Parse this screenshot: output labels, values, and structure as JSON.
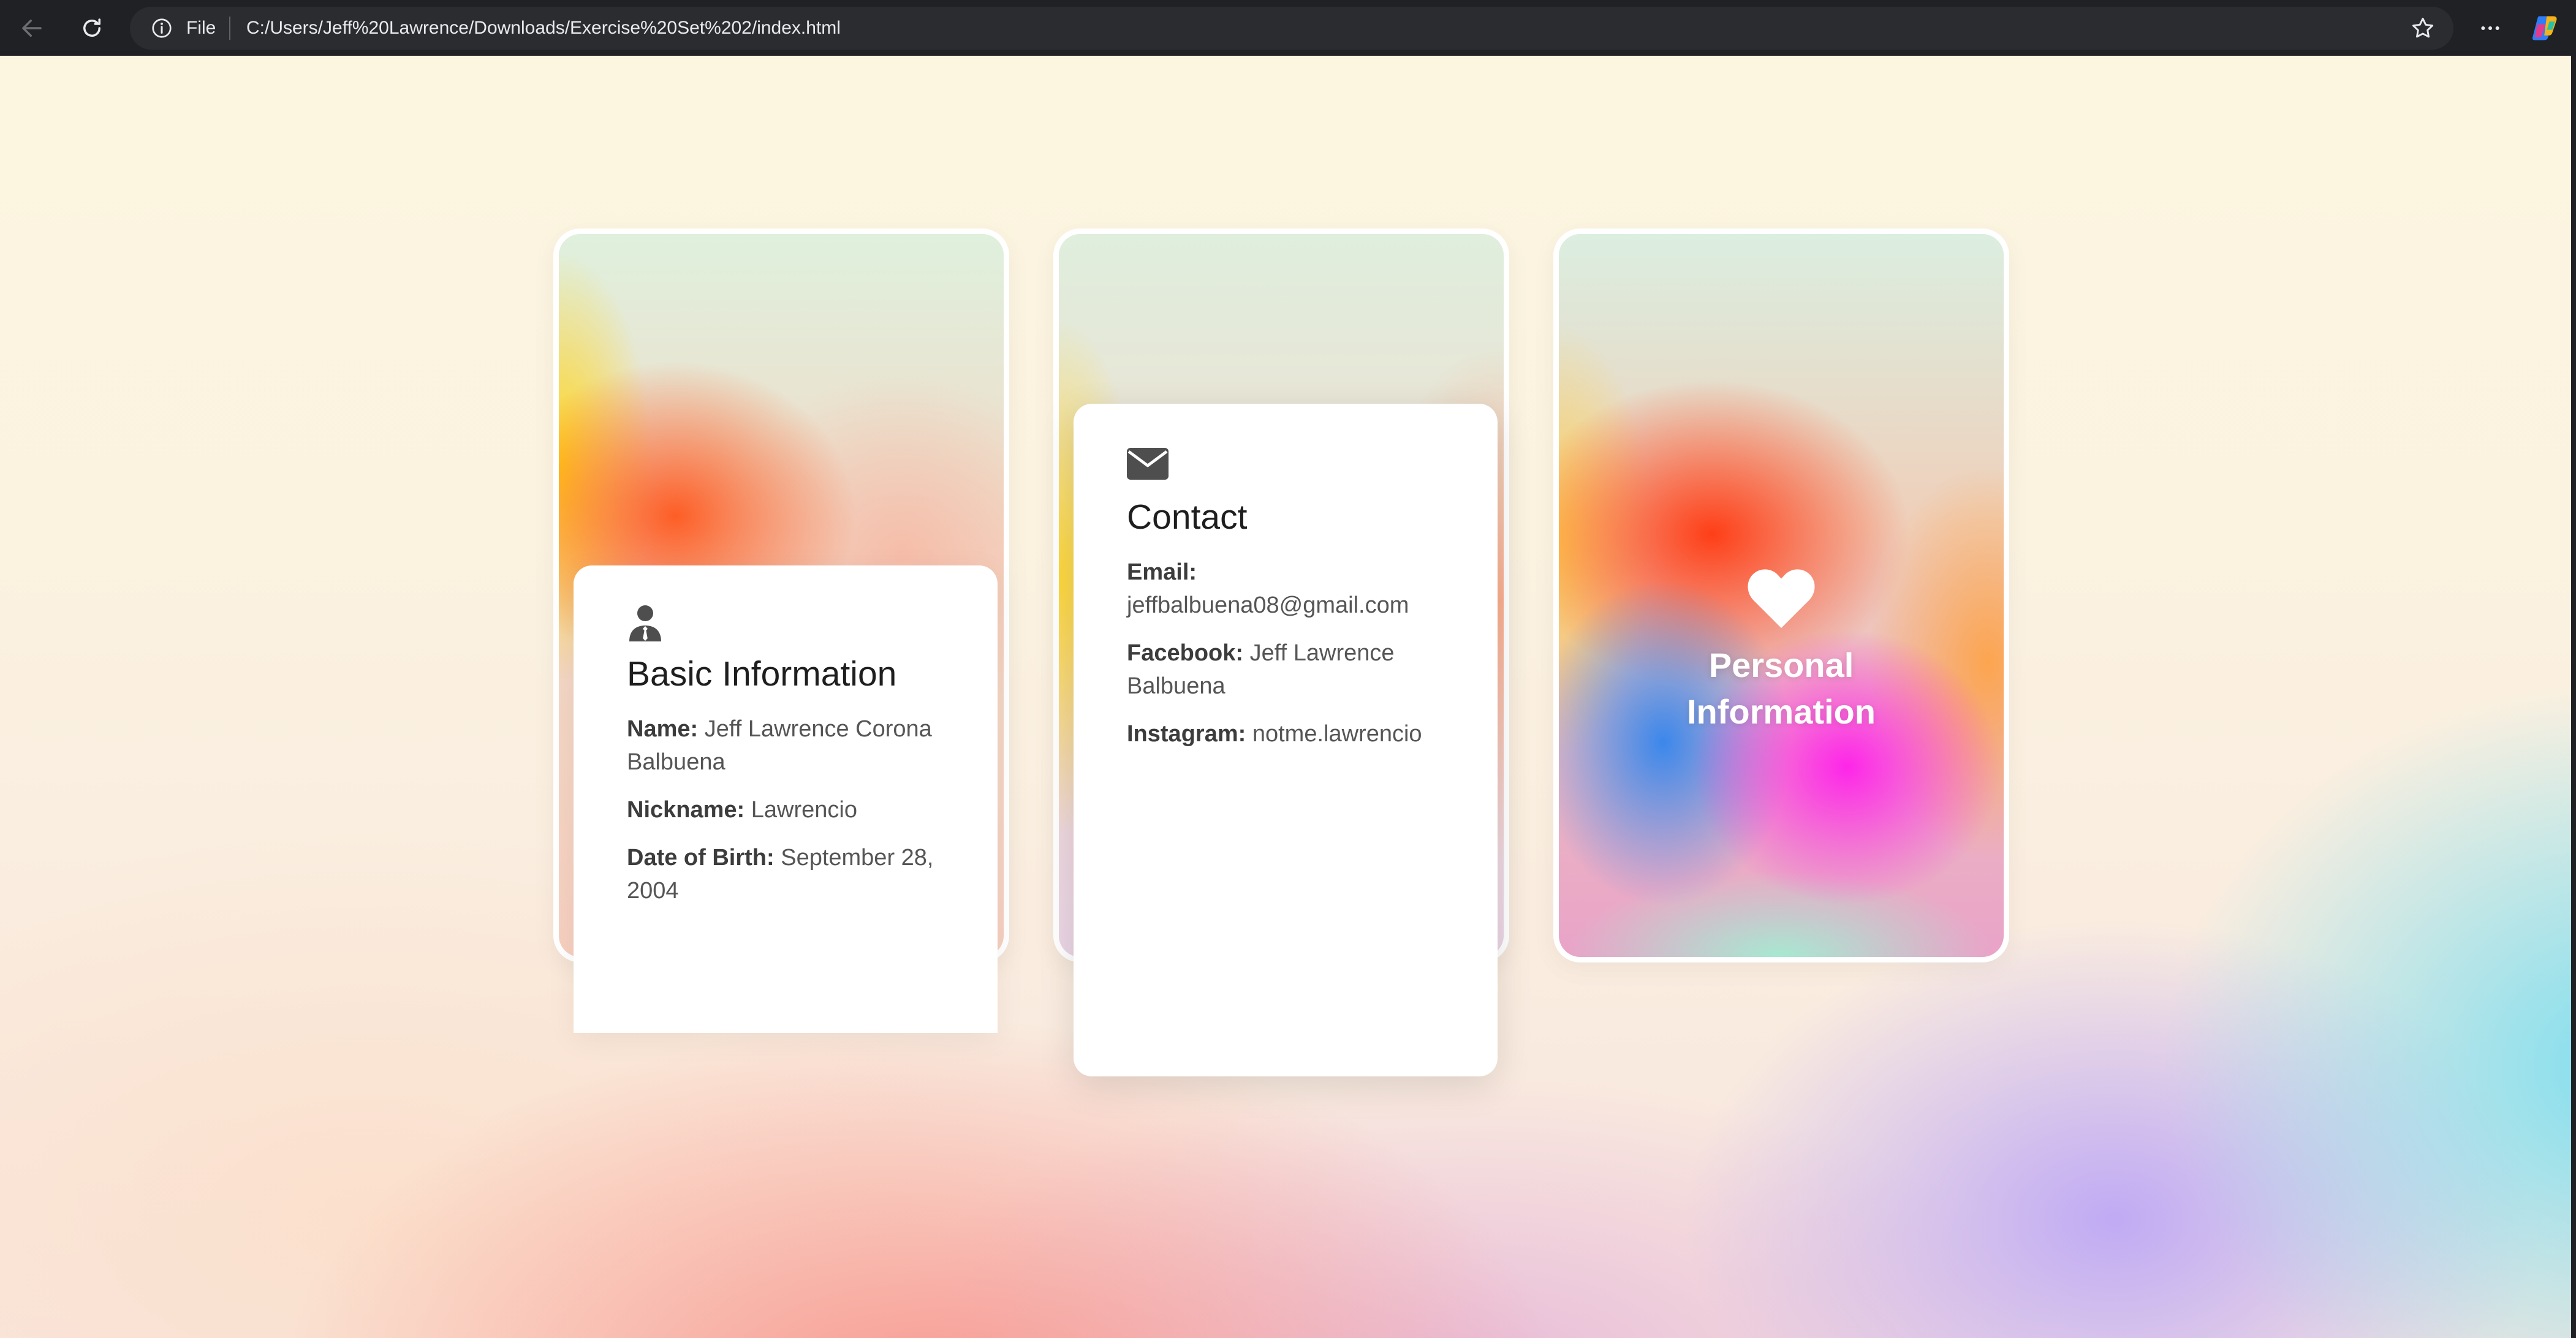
{
  "browser": {
    "scheme": "File",
    "url": "C:/Users/Jeff%20Lawrence/Downloads/Exercise%20Set%202/index.html"
  },
  "cards": {
    "basic": {
      "icon": "user-tie-icon",
      "title": "Basic Information",
      "fields": [
        {
          "label": "Name:",
          "value": "Jeff Lawrence Corona Balbuena"
        },
        {
          "label": "Nickname:",
          "value": "Lawrencio"
        },
        {
          "label": "Date of Birth:",
          "value": "September 28, 2004"
        }
      ]
    },
    "contact": {
      "icon": "envelope-icon",
      "title": "Contact",
      "fields": [
        {
          "label": "Email:",
          "value": "jeffbalbuena08@gmail.com"
        },
        {
          "label": "Facebook:",
          "value": "Jeff Lawrence Balbuena"
        },
        {
          "label": "Instagram:",
          "value": "notme.lawrencio"
        }
      ]
    },
    "personal": {
      "icon": "heart-icon",
      "title": "Personal Information"
    }
  },
  "colors": {
    "chrome_bg": "#202124",
    "panel_bg": "#ffffff",
    "text_dark": "#1e1e1e",
    "text_body": "#555555"
  }
}
